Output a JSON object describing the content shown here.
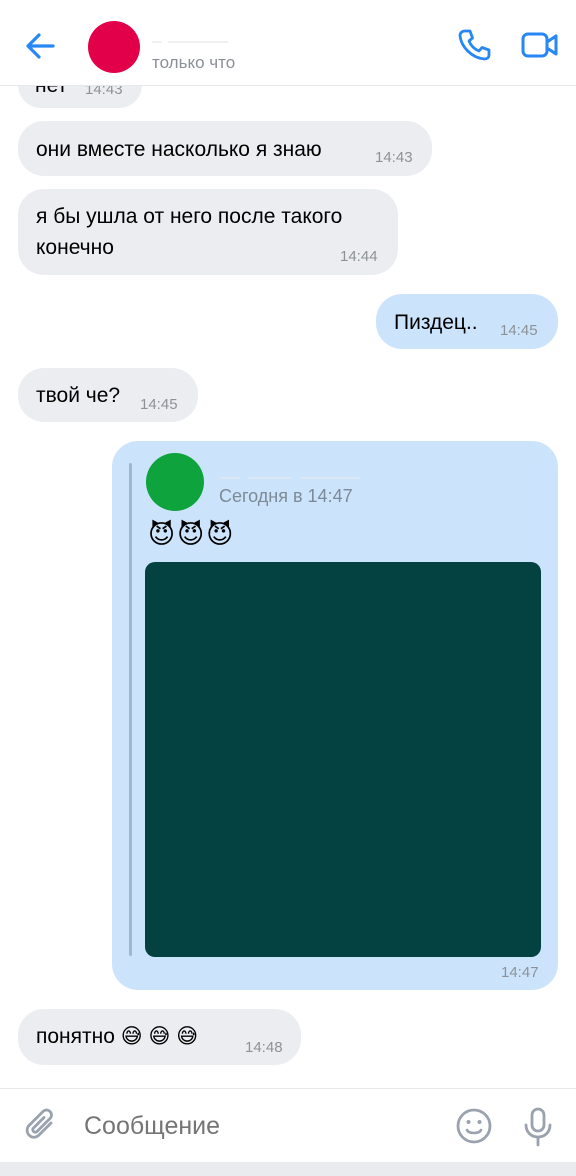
{
  "header": {
    "status": "только что"
  },
  "messages": [
    {
      "text": "нет",
      "time": "14:43"
    },
    {
      "text": "они вместе насколько я знаю",
      "time": "14:43"
    },
    {
      "line1": "я бы ушла от него после такого",
      "line2": "конечно",
      "time": "14:44"
    },
    {
      "text": "Пиздец..",
      "time": "14:45"
    },
    {
      "text": "твой че?",
      "time": "14:45"
    },
    {
      "forwarded_date": "Сегодня в 14:47",
      "forwarded_text": "😈😈😈",
      "time": "14:47"
    },
    {
      "text": "понятно 😅 😅 😅",
      "time": "14:48"
    }
  ],
  "composer": {
    "placeholder": "Сообщение"
  },
  "colors": {
    "accent": "#2787f5",
    "incoming_bubble": "#ebedf0",
    "outgoing_bubble": "#cce4fb",
    "header_avatar": "#e2004b",
    "forward_avatar": "#0ea33d",
    "image_fill": "#034240"
  },
  "icons": [
    "arrow-left-icon",
    "phone-icon",
    "video-camera-icon",
    "paperclip-icon",
    "smile-icon",
    "microphone-icon"
  ]
}
